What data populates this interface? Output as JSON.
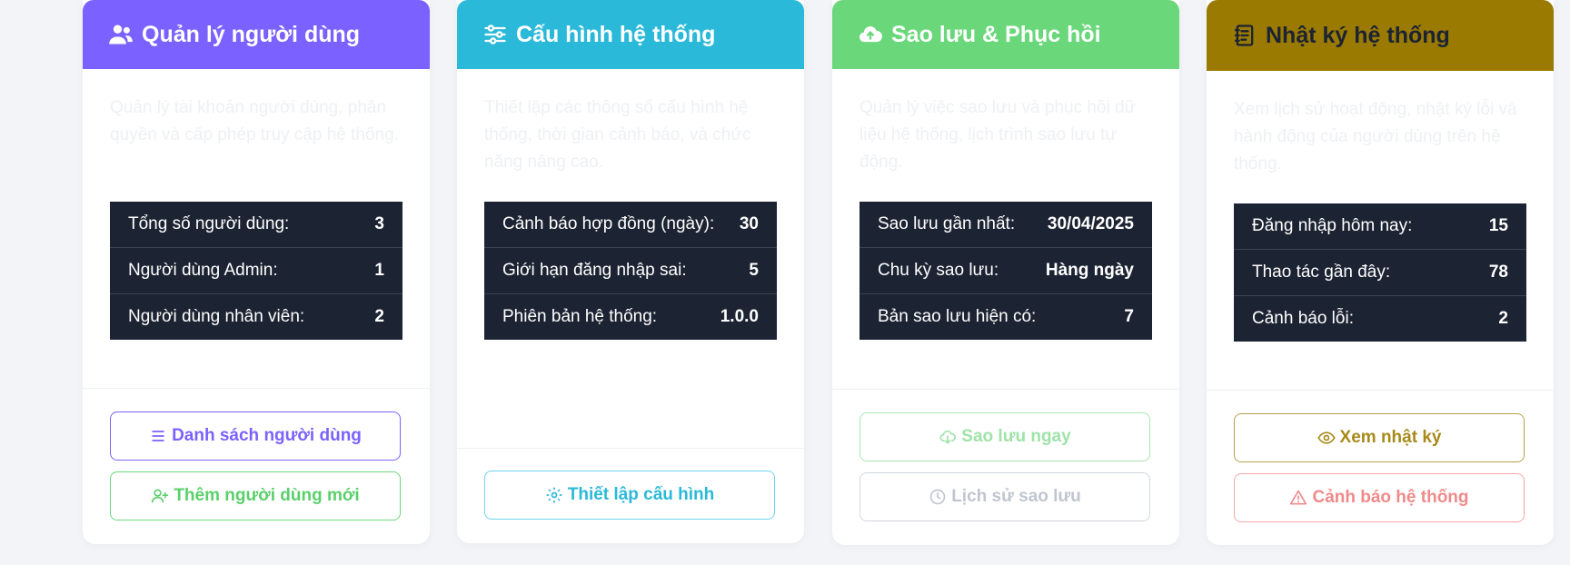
{
  "colors": {
    "users": "#7b61ff",
    "config": "#2bb9d9",
    "backup": "#6ad87a",
    "logs": "#9a7a00",
    "stats_bg": "#1c2332"
  },
  "cards": [
    {
      "title": "Quản lý người dùng",
      "icon": "users-icon",
      "description": "Quản lý tài khoản người dùng, phân quyền và cấp phép truy cập hệ thống.",
      "stats": [
        {
          "label": "Tổng số người dùng:",
          "value": "3"
        },
        {
          "label": "Người dùng Admin:",
          "value": "1"
        },
        {
          "label": "Người dùng nhân viên:",
          "value": "2"
        }
      ],
      "buttons": [
        {
          "label": "Danh sách người dùng",
          "icon": "list-icon"
        },
        {
          "label": "Thêm người dùng mới",
          "icon": "user-plus-icon"
        }
      ]
    },
    {
      "title": "Cấu hình hệ thống",
      "icon": "sliders-icon",
      "description": "Thiết lập các thông số cấu hình hệ thống, thời gian cảnh báo, và chức năng nâng cao.",
      "stats": [
        {
          "label": "Cảnh báo hợp đồng (ngày):",
          "value": "30"
        },
        {
          "label": "Giới hạn đăng nhập sai:",
          "value": "5"
        },
        {
          "label": "Phiên bản hệ thống:",
          "value": "1.0.0"
        }
      ],
      "buttons": [
        {
          "label": "Thiết lập cấu hình",
          "icon": "gear-icon"
        }
      ]
    },
    {
      "title": "Sao lưu & Phục hồi",
      "icon": "cloud-upload-icon",
      "description": "Quản lý việc sao lưu và phục hồi dữ liệu hệ thống, lịch trình sao lưu tự động.",
      "stats": [
        {
          "label": "Sao lưu gần nhất:",
          "value": "30/04/2025"
        },
        {
          "label": "Chu kỳ sao lưu:",
          "value": "Hàng ngày"
        },
        {
          "label": "Bản sao lưu hiện có:",
          "value": "7"
        }
      ],
      "buttons": [
        {
          "label": "Sao lưu ngay",
          "icon": "cloud-download-icon"
        },
        {
          "label": "Lịch sử sao lưu",
          "icon": "clock-icon"
        }
      ]
    },
    {
      "title": "Nhật ký hệ thống",
      "icon": "journal-icon",
      "description": "Xem lịch sử hoạt động, nhật ký lỗi và hành động của người dùng trên hệ thống.",
      "stats": [
        {
          "label": "Đăng nhập hôm nay:",
          "value": "15"
        },
        {
          "label": "Thao tác gần đây:",
          "value": "78"
        },
        {
          "label": "Cảnh báo lỗi:",
          "value": "2"
        }
      ],
      "buttons": [
        {
          "label": "Xem nhật ký",
          "icon": "eye-icon"
        },
        {
          "label": "Cảnh báo hệ thống",
          "icon": "warning-icon"
        }
      ]
    }
  ]
}
